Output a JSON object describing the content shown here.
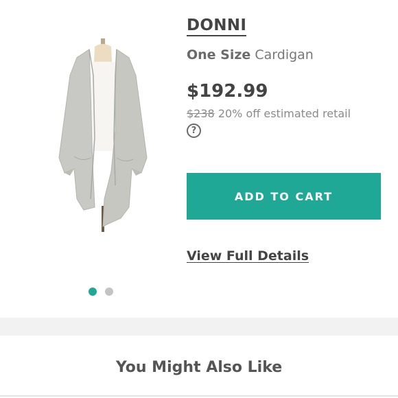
{
  "product": {
    "brand": "DONNI",
    "size": "One Size",
    "category": "Cardigan",
    "price": "$192.99",
    "retail_price": "$238",
    "discount_text": "20% off estimated retail",
    "help_icon": "question-circle-icon",
    "image_icon": "cardigan-on-mannequin"
  },
  "actions": {
    "add_to_cart": "ADD TO CART",
    "view_details": "View Full Details"
  },
  "carousel": {
    "total": 2,
    "active_index": 0
  },
  "recommendations": {
    "title": "You Might Also Like"
  },
  "colors": {
    "accent": "#1fa896",
    "text": "#444444",
    "muted": "#8a8a8a"
  }
}
